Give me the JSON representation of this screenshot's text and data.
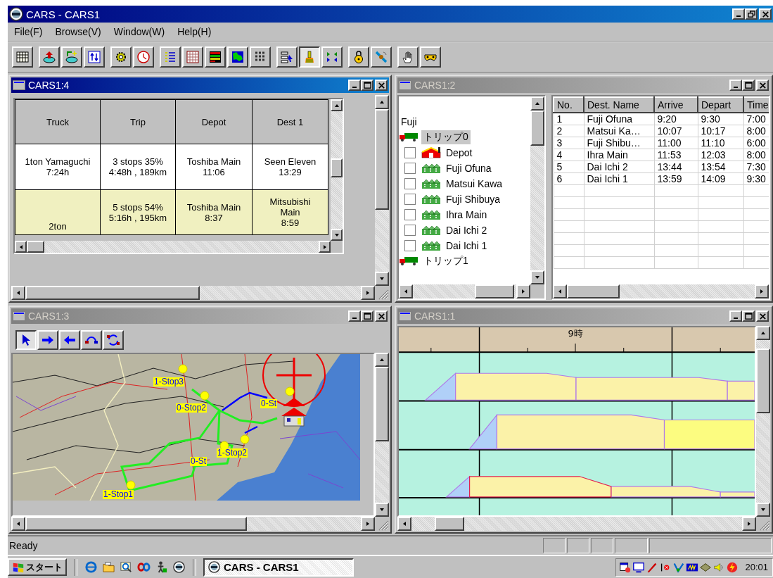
{
  "window": {
    "title": "CARS - CARS1"
  },
  "menu": [
    "File(F)",
    "Browse(V)",
    "Window(W)",
    "Help(H)"
  ],
  "toolbar": [
    [
      {
        "pressed": false
      }
    ],
    [
      {
        "pressed": false
      },
      {
        "pressed": false
      },
      {
        "pressed": false
      }
    ],
    [
      {
        "pressed": false
      },
      {
        "pressed": false
      }
    ],
    [
      {
        "pressed": false
      },
      {
        "pressed": false
      },
      {
        "pressed": false
      },
      {
        "pressed": false
      },
      {
        "pressed": false
      }
    ],
    [
      {
        "pressed": false
      },
      {
        "pressed": true
      },
      {
        "pressed": false
      }
    ],
    [
      {
        "pressed": false
      },
      {
        "pressed": false
      }
    ],
    [
      {
        "pressed": false
      },
      {
        "pressed": false
      }
    ]
  ],
  "children": [
    {
      "kind": "grid",
      "title": "CARS1:4",
      "active": true,
      "columns": [
        "Truck",
        "Trip",
        "Depot",
        "Dest 1"
      ],
      "rows": [
        {
          "selected": false,
          "cells": [
            "1ton Yamaguchi\n7:24h",
            "3 stops 35%\n4:48h , 189km",
            "Toshiba Main\n11:06",
            "Seen Eleven\n13:29"
          ]
        },
        {
          "selected": true,
          "cells": [
            "2ton",
            "5 stops 54%\n5:16h , 195km",
            "Toshiba Main\n8:37",
            "Mitsubishi\nMain\n8:59"
          ]
        }
      ]
    },
    {
      "kind": "route",
      "title": "CARS1:2",
      "active": false,
      "tree": [
        {
          "label": "Fuji",
          "children": [
            {
              "label": "トリップ0",
              "selected": true,
              "children": [
                {
                  "label": "Depot",
                  "kind": "depot",
                  "checked": false
                },
                {
                  "label": "Fuji Ofuna",
                  "kind": "destination",
                  "checked": false
                },
                {
                  "label": "Matsui Kawa",
                  "kind": "destination",
                  "checked": false
                },
                {
                  "label": "Fuji Shibuya",
                  "kind": "destination",
                  "checked": false
                },
                {
                  "label": "Ihra Main",
                  "kind": "destination",
                  "checked": false
                },
                {
                  "label": "Dai Ichi 2",
                  "kind": "destination",
                  "checked": false
                },
                {
                  "label": "Dai Ichi 1",
                  "kind": "destination",
                  "checked": false
                }
              ]
            },
            {
              "label": "トリップ1",
              "selected": false
            }
          ]
        }
      ],
      "table": {
        "columns": [
          "No.",
          "Dest. Name",
          "Arrive",
          "Depart",
          "Time"
        ],
        "rows": [
          [
            "1",
            "Fuji Ofuna",
            "9:20",
            "9:30",
            "7:00"
          ],
          [
            "2",
            "Matsui Ka…",
            "10:07",
            "10:17",
            "8:00"
          ],
          [
            "3",
            "Fuji Shibu…",
            "11:00",
            "11:10",
            "6:00"
          ],
          [
            "4",
            "Ihra Main",
            "11:53",
            "12:03",
            "8:00"
          ],
          [
            "5",
            "Dai Ichi 2",
            "13:44",
            "13:54",
            "7:30"
          ],
          [
            "6",
            "Dai Ichi 1",
            "13:59",
            "14:09",
            "9:30"
          ]
        ]
      }
    },
    {
      "kind": "map",
      "title": "CARS1:3",
      "active": false,
      "tools": [
        {
          "selected": true
        },
        {
          "selected": false
        },
        {
          "selected": false
        },
        {
          "selected": false
        },
        {
          "selected": false
        }
      ],
      "stops": [
        "1-Stop3",
        "0-St",
        "0-Stop2",
        "1-Stop2",
        "0-St",
        "1-Stop1"
      ]
    },
    {
      "kind": "schedule",
      "title": "CARS1:1",
      "active": false,
      "hour_label": "9時"
    }
  ],
  "status_bar": {
    "text": "Ready"
  },
  "taskbar": {
    "start": "スタート",
    "task": "CARS - CARS1",
    "clock": "20:01"
  }
}
